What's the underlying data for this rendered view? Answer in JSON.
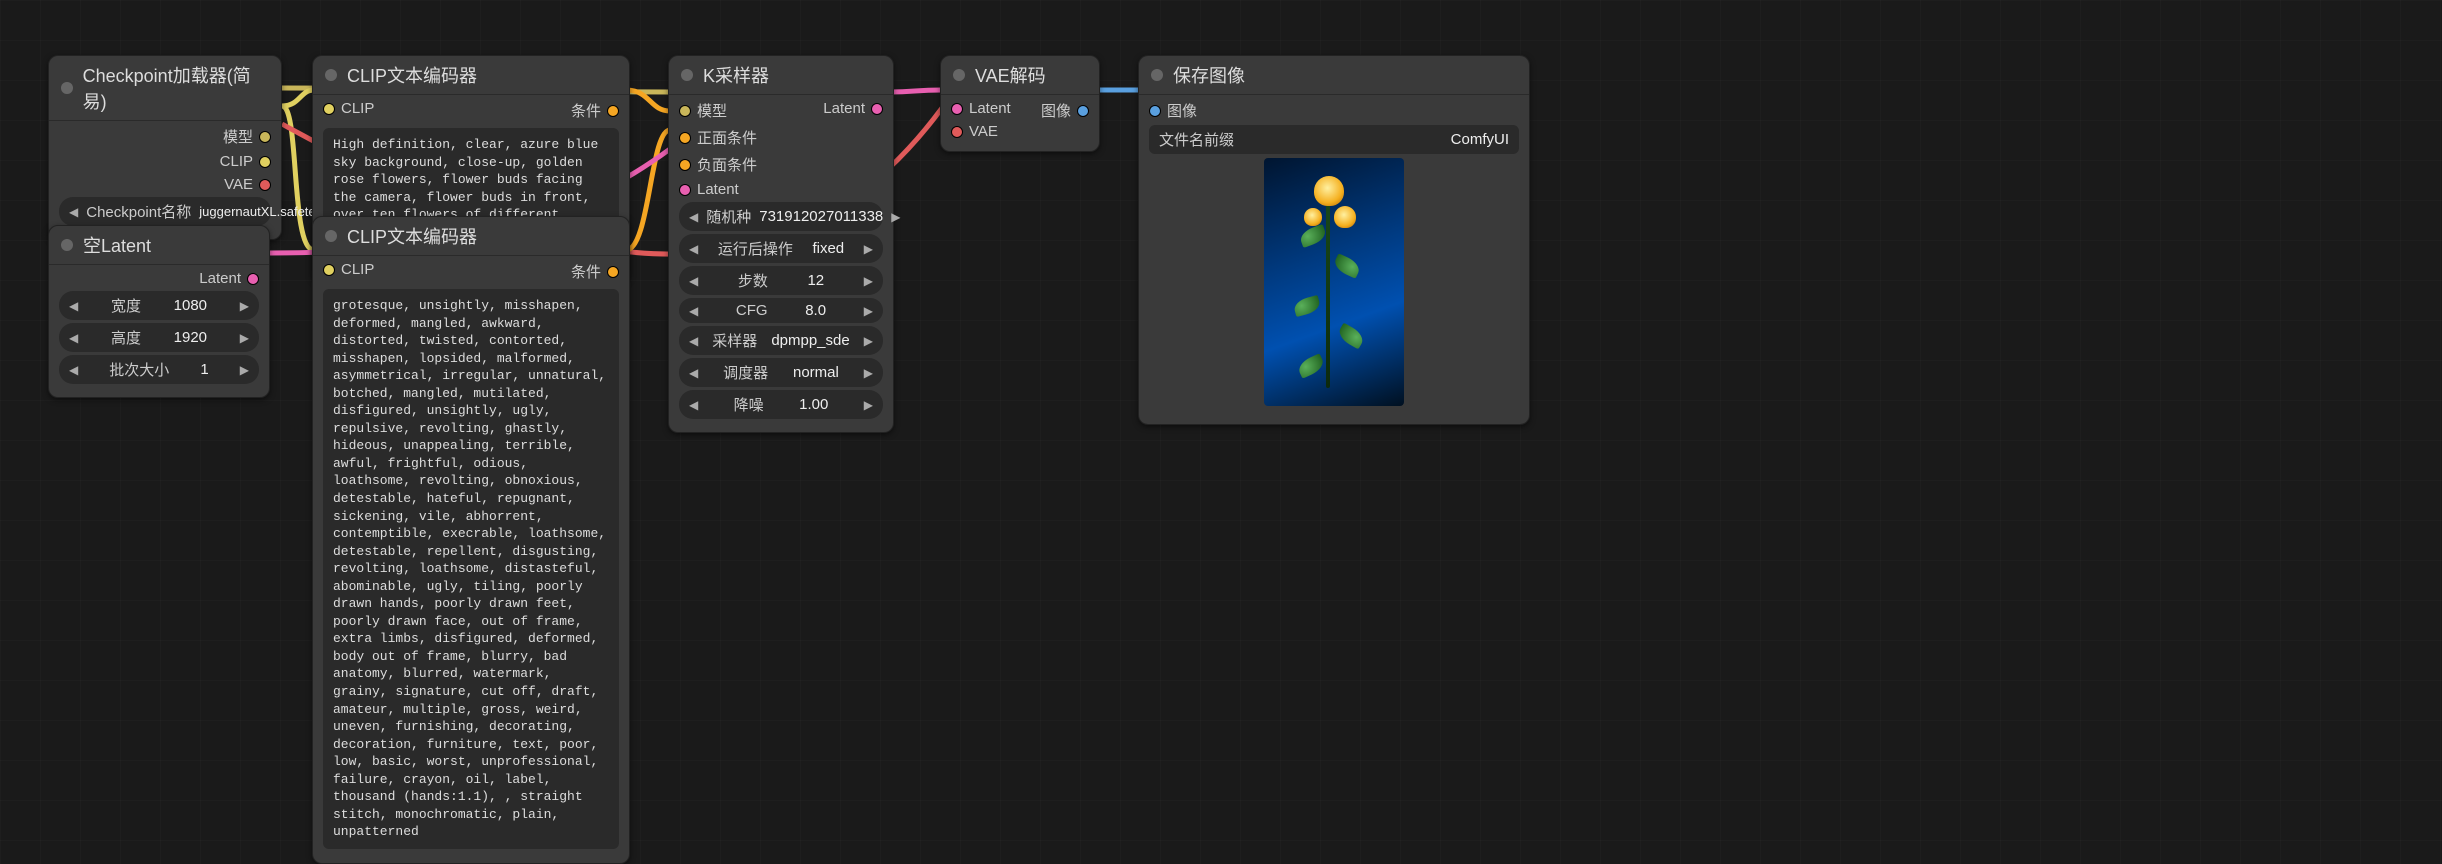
{
  "nodes": {
    "checkpoint": {
      "title": "Checkpoint加载器(简易)",
      "outputs": {
        "model": "模型",
        "clip": "CLIP",
        "vae": "VAE"
      },
      "widget": {
        "label": "Checkpoint名称",
        "value": "juggernautXL.safetensors"
      }
    },
    "empty_latent": {
      "title": "空Latent",
      "outputs": {
        "latent": "Latent"
      },
      "widgets": {
        "width": {
          "label": "宽度",
          "value": "1080"
        },
        "height": {
          "label": "高度",
          "value": "1920"
        },
        "batch": {
          "label": "批次大小",
          "value": "1"
        }
      }
    },
    "clip_pos": {
      "title": "CLIP文本编码器",
      "inputs": {
        "clip": "CLIP"
      },
      "outputs": {
        "cond": "条件"
      },
      "text": "High definition, clear, azure blue sky background, close-up, golden rose flowers, flower buds facing the camera, flower buds in front, over ten flowers of different sizes, dense leaves, and rich details"
    },
    "clip_neg": {
      "title": "CLIP文本编码器",
      "inputs": {
        "clip": "CLIP"
      },
      "outputs": {
        "cond": "条件"
      },
      "text": "grotesque, unsightly, misshapen, deformed, mangled, awkward, distorted, twisted, contorted, misshapen, lopsided, malformed, asymmetrical, irregular, unnatural, botched, mangled, mutilated, disfigured, unsightly, ugly, repulsive, revolting, ghastly, hideous, unappealing, terrible, awful, frightful, odious, loathsome, revolting, obnoxious, detestable, hateful, repugnant, sickening, vile, abhorrent, contemptible, execrable, loathsome, detestable, repellent, disgusting, revolting, loathsome, distasteful, abominable, ugly, tiling, poorly drawn hands, poorly drawn feet, poorly drawn face, out of frame, extra limbs, disfigured, deformed, body out of frame, blurry, bad anatomy, blurred, watermark, grainy, signature, cut off, draft, amateur, multiple, gross, weird, uneven, furnishing, decorating, decoration, furniture, text, poor, low, basic, worst, unprofessional, failure, crayon, oil, label, thousand (hands:1.1), , straight stitch, monochromatic, plain, unpatterned"
    },
    "ksampler": {
      "title": "K采样器",
      "inputs": {
        "model": "模型",
        "pos": "正面条件",
        "neg": "负面条件",
        "latent": "Latent"
      },
      "outputs": {
        "latent": "Latent"
      },
      "widgets": {
        "seed": {
          "label": "随机种",
          "value": "731912027011338"
        },
        "after": {
          "label": "运行后操作",
          "value": "fixed"
        },
        "steps": {
          "label": "步数",
          "value": "12"
        },
        "cfg": {
          "label": "CFG",
          "value": "8.0"
        },
        "sampler": {
          "label": "采样器",
          "value": "dpmpp_sde"
        },
        "scheduler": {
          "label": "调度器",
          "value": "normal"
        },
        "denoise": {
          "label": "降噪",
          "value": "1.00"
        }
      }
    },
    "vae_decode": {
      "title": "VAE解码",
      "inputs": {
        "latent": "Latent",
        "vae": "VAE"
      },
      "outputs": {
        "image": "图像"
      }
    },
    "save_image": {
      "title": "保存图像",
      "inputs": {
        "image": "图像"
      },
      "widget": {
        "label": "文件名前缀",
        "value": "ComfyUI"
      }
    }
  }
}
